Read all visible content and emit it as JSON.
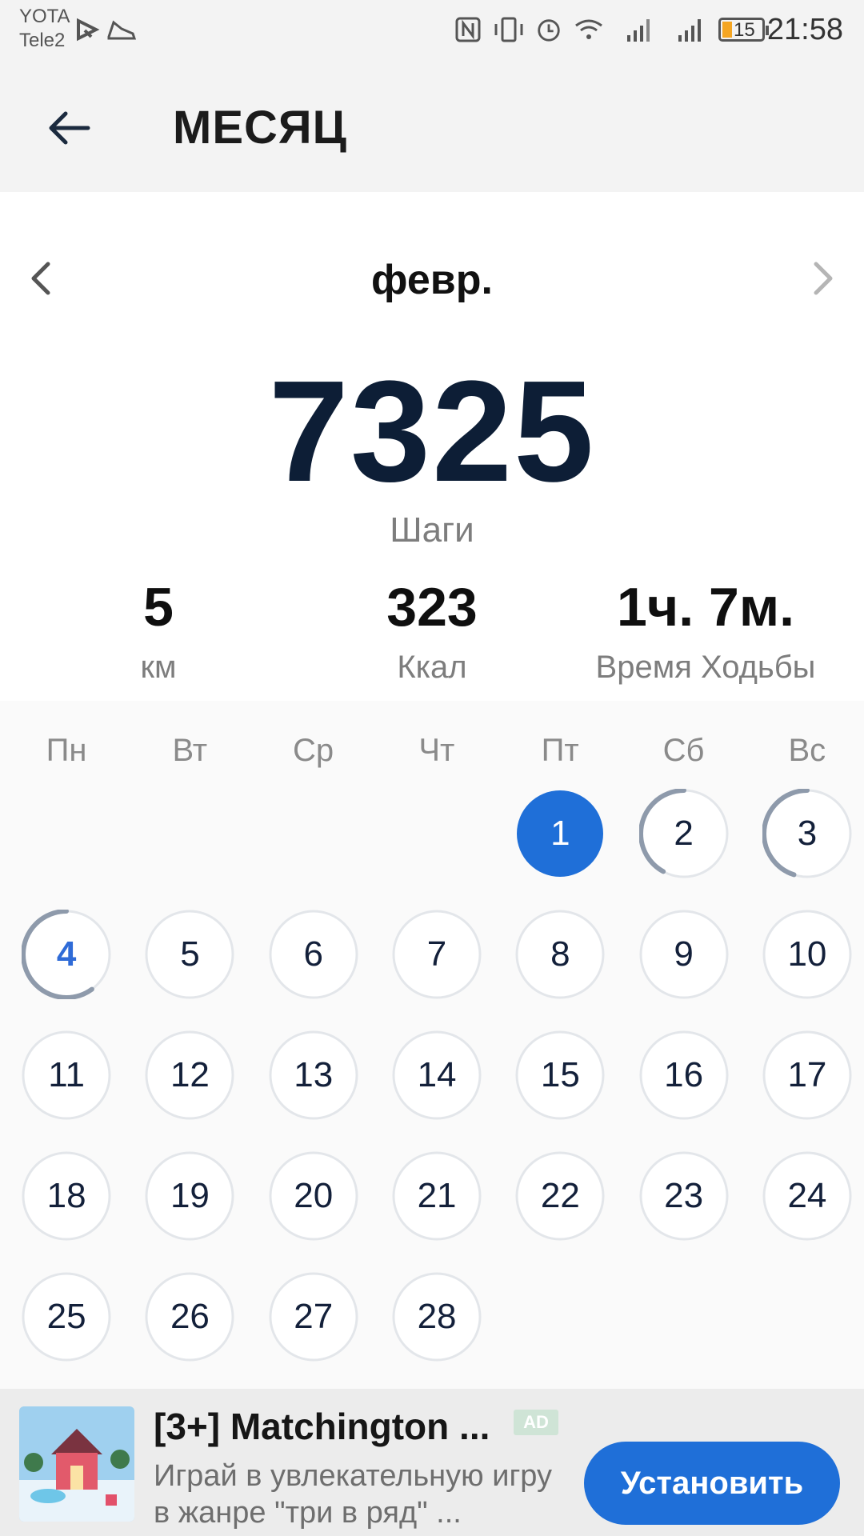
{
  "status_bar": {
    "carrier_1": "YOTA",
    "carrier_2": "Tele2",
    "battery_level": "15",
    "time": "21:58",
    "icons": [
      "play-icon",
      "shoe-icon",
      "nfc-icon",
      "vibrate-icon",
      "alarm-icon",
      "wifi-icon",
      "signal-icon",
      "signal-icon"
    ]
  },
  "header": {
    "back_icon": "arrow-left-icon",
    "title": "МЕСЯЦ"
  },
  "summary": {
    "month": "февр.",
    "steps": "7325",
    "steps_label": "Шаги",
    "stats": [
      {
        "value": "5",
        "label": "км"
      },
      {
        "value": "323",
        "label": "Ккал"
      },
      {
        "value": "1ч. 7м.",
        "label": "Время Ходьбы"
      }
    ]
  },
  "calendar": {
    "weekdays": [
      "Пн",
      "Вт",
      "Ср",
      "Чт",
      "Пт",
      "Сб",
      "Вс"
    ],
    "first_weekday_index": 4,
    "days": [
      "1",
      "2",
      "3",
      "4",
      "5",
      "6",
      "7",
      "8",
      "9",
      "10",
      "11",
      "12",
      "13",
      "14",
      "15",
      "16",
      "17",
      "18",
      "19",
      "20",
      "21",
      "22",
      "23",
      "24",
      "25",
      "26",
      "27",
      "28"
    ],
    "selected_day": "1",
    "today": "4",
    "progress": {
      "1": 1.0,
      "2": 0.42,
      "3": 0.45,
      "4": 0.6
    },
    "colors": {
      "accent": "#1f6fd8",
      "progress": "#8e9aab",
      "ring": "#e3e6ea",
      "today": "#2f6bd7"
    }
  },
  "ad": {
    "title": "[3+] Matchington ...",
    "badge": "AD",
    "description": "Играй в увлекательную игру в жанре \"три в ряд\" ...",
    "button": "Установить"
  }
}
